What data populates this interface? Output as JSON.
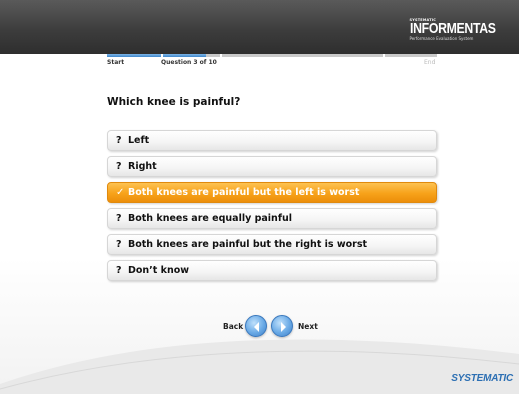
{
  "brand": {
    "small_text": "SYSTEMATIC",
    "name": "INFORMENTAS",
    "tagline": "Performance Evaluation System"
  },
  "progress": {
    "start_label": "Start",
    "current_label": "Question 3 of 10",
    "end_label": "End",
    "fraction_complete": 0.3,
    "fill_color": "#3d86cc"
  },
  "question": {
    "text": "Which knee is painful?"
  },
  "options": [
    {
      "marker": "?",
      "label": "Left",
      "selected": false
    },
    {
      "marker": "?",
      "label": "Right",
      "selected": false
    },
    {
      "marker": "✓",
      "label": "Both knees are painful but the left is worst",
      "selected": true
    },
    {
      "marker": "?",
      "label": "Both knees are equally painful",
      "selected": false
    },
    {
      "marker": "?",
      "label": "Both knees are painful but the right is worst",
      "selected": false
    },
    {
      "marker": "?",
      "label": "Don’t know",
      "selected": false
    }
  ],
  "navigation": {
    "back_label": "Back",
    "next_label": "Next",
    "back_icon": "chevron-left-icon",
    "next_icon": "chevron-right-icon"
  },
  "footer": {
    "logo_text": "SYSTEMATIC"
  },
  "colors": {
    "selected_option": "#f7a21a",
    "nav_button": "#6aaae6",
    "footer_logo": "#2c6fb3"
  }
}
